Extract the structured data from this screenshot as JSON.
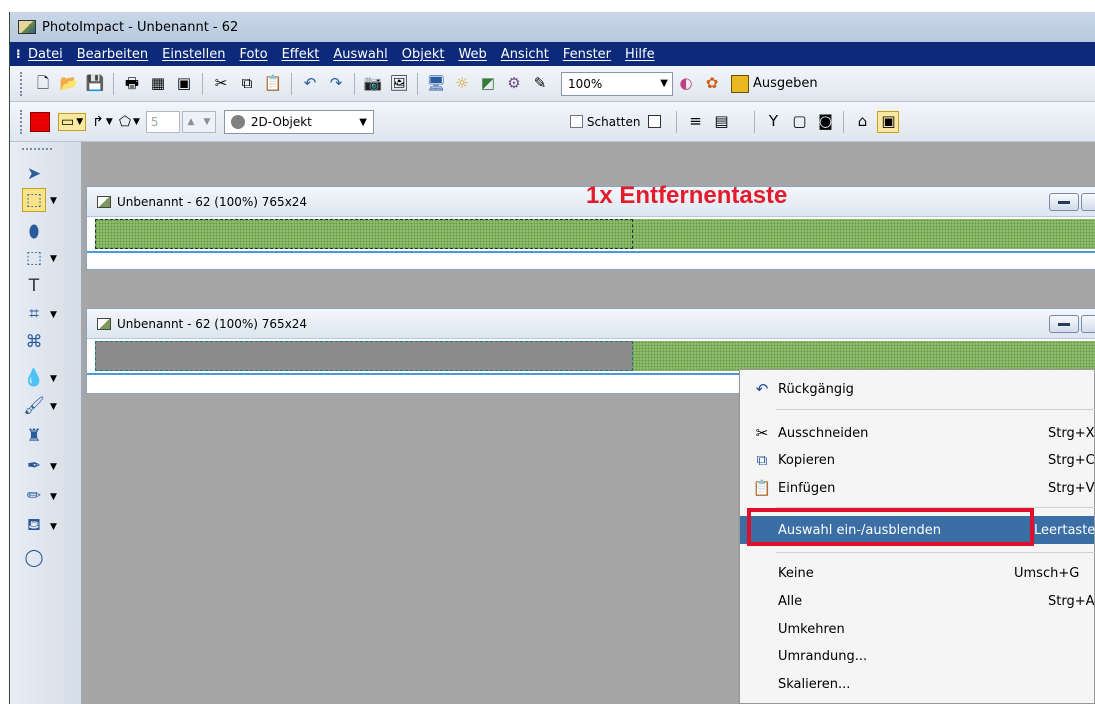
{
  "window": {
    "title": "PhotoImpact - Unbenannt - 62"
  },
  "menubar": {
    "items": [
      "Datei",
      "Bearbeiten",
      "Einstellen",
      "Foto",
      "Effekt",
      "Auswahl",
      "Objekt",
      "Web",
      "Ansicht",
      "Fenster",
      "Hilfe"
    ]
  },
  "toolbar1": {
    "zoom_value": "100%",
    "output_label": "Ausgeben"
  },
  "toolbar2": {
    "line_width": "5",
    "object_type": "2D-Objekt",
    "shadow_label": "Schatten",
    "fill_color": "#e80000"
  },
  "documents": [
    {
      "title": "Unbenannt - 62 (100%) 765x24"
    },
    {
      "title": "Unbenannt - 62 (100%) 765x24"
    }
  ],
  "annotation": "1x Entfernentaste",
  "context_menu": {
    "items": [
      {
        "label": "Rückgängig",
        "shortcut": ""
      },
      {
        "label": "Ausschneiden",
        "shortcut": "Strg+X"
      },
      {
        "label": "Kopieren",
        "shortcut": "Strg+C"
      },
      {
        "label": "Einfügen",
        "shortcut": "Strg+V"
      },
      {
        "label": "Auswahl ein-/ausblenden",
        "shortcut": "Leertaste"
      },
      {
        "label": "Keine",
        "shortcut": "Umsch+G"
      },
      {
        "label": "Alle",
        "shortcut": "Strg+A"
      },
      {
        "label": "Umkehren",
        "shortcut": ""
      },
      {
        "label": "Umrandung...",
        "shortcut": ""
      },
      {
        "label": "Skalieren...",
        "shortcut": ""
      }
    ]
  },
  "colors": {
    "highlight": "#3a6ea5",
    "annotation": "#e21c2c",
    "menubar": "#0d2a7a"
  }
}
